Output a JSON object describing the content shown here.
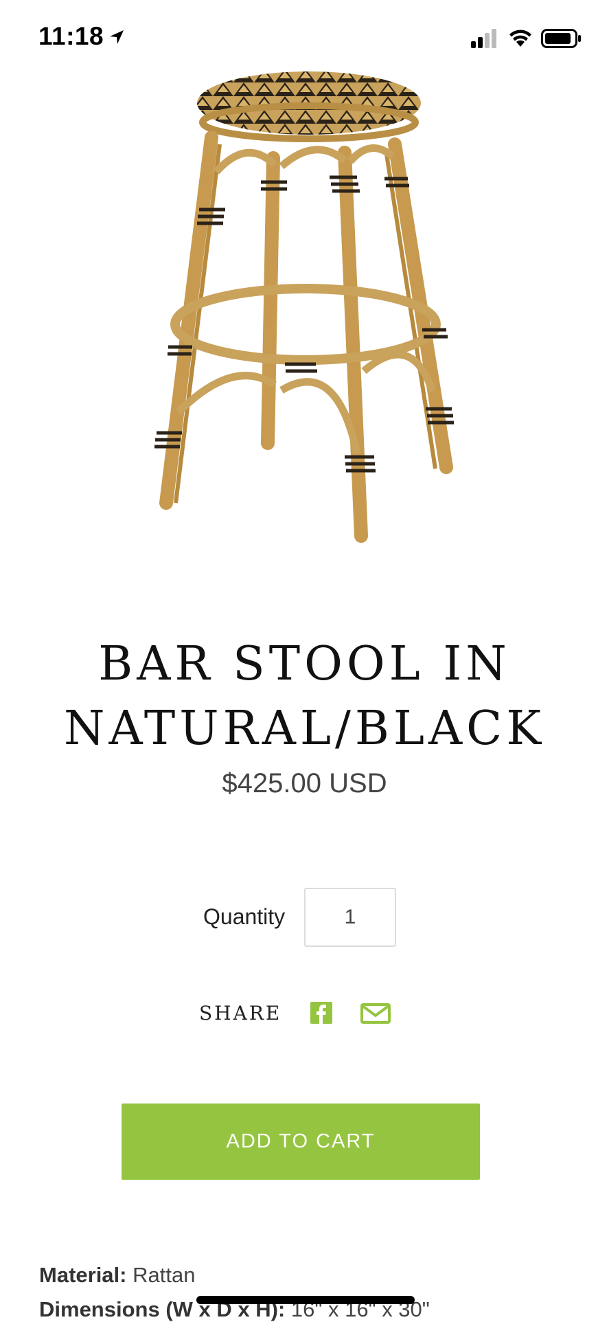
{
  "status_bar": {
    "time": "11:18"
  },
  "product": {
    "image_alt": "rattan bar stool",
    "title": "BAR STOOL IN NATURAL/BLACK",
    "price": "$425.00 USD"
  },
  "quantity": {
    "label": "Quantity",
    "value": "1"
  },
  "share": {
    "label": "SHARE"
  },
  "cart": {
    "button_label": "ADD TO CART"
  },
  "specs": [
    {
      "label": "Material:",
      "value": " Rattan"
    },
    {
      "label": "Dimensions (W x D x H):",
      "value": " 16\" x 16\" x 30\""
    }
  ],
  "colors": {
    "accent": "#95c540",
    "rattan": "#c9a25c",
    "weave_dark": "#2b2218"
  }
}
